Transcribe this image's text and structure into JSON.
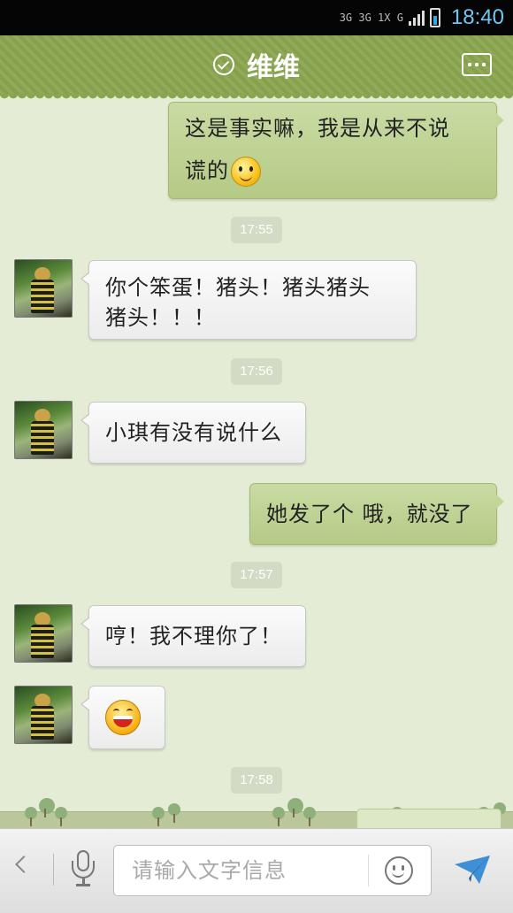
{
  "status_bar": {
    "network": "3G 3G 1X G",
    "time": "18:40"
  },
  "header": {
    "title": "维维",
    "more_icon": "more-dots-icon",
    "verified_icon": "check-circle-icon"
  },
  "messages": [
    {
      "type": "out",
      "text": "这是事实嘛，我是从来不说",
      "text2": "谎的",
      "emoji": "smile"
    },
    {
      "type": "time",
      "text": "17:55"
    },
    {
      "type": "in",
      "text": "你个笨蛋！猪头！猪头猪头",
      "text2": "猪头！！！"
    },
    {
      "type": "time",
      "text": "17:56"
    },
    {
      "type": "in",
      "text": "小琪有没有说什么"
    },
    {
      "type": "out",
      "text": "她发了个 哦，就没了"
    },
    {
      "type": "time",
      "text": "17:57"
    },
    {
      "type": "in",
      "text": "哼！我不理你了！"
    },
    {
      "type": "in",
      "emoji": "laugh"
    },
    {
      "type": "time",
      "text": "17:58"
    }
  ],
  "input_bar": {
    "placeholder": "请输入文字信息",
    "icons": [
      "back-arrow-icon",
      "microphone-icon",
      "emoji-icon",
      "send-icon"
    ]
  },
  "colors": {
    "header": "#8aa54f",
    "background": "#e4ecd6",
    "out_bubble": "#c2d59b",
    "in_bubble": "#f5f5f5",
    "time_color": "#6fc7f2"
  }
}
